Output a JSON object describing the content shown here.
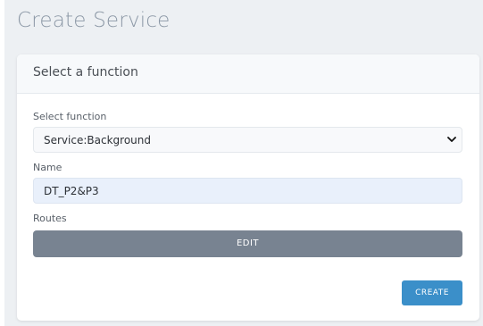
{
  "page": {
    "title": "Create Service"
  },
  "card": {
    "title": "Select a function"
  },
  "form": {
    "function_label": "Select function",
    "function_value": "Service:Background",
    "name_label": "Name",
    "name_value": "DT_P2&P3",
    "routes_label": "Routes",
    "edit_label": "EDIT",
    "create_label": "CREATE"
  },
  "icons": {
    "select_chevron": "chevron-down-icon"
  },
  "colors": {
    "page_background": "#edf0f3",
    "edit_button": "#788391",
    "create_button": "#3b8fc9",
    "name_input_background": "#e9f0fb"
  }
}
